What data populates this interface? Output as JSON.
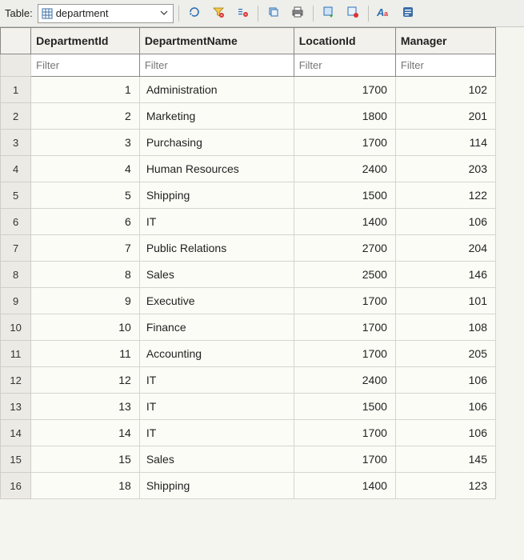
{
  "toolbar": {
    "label": "Table:",
    "table_name": "department",
    "icons": {
      "refresh": "refresh-icon",
      "filter": "filter-icon",
      "clear_filter": "clear-filter-icon",
      "copy": "copy-icon",
      "print": "print-icon",
      "export_sql": "export-sql-icon",
      "export": "export-icon",
      "format": "format-icon",
      "more": "more-icon"
    }
  },
  "grid": {
    "columns": [
      {
        "key": "DepartmentId",
        "label": "DepartmentId",
        "filter_placeholder": "Filter"
      },
      {
        "key": "DepartmentName",
        "label": "DepartmentName",
        "filter_placeholder": "Filter"
      },
      {
        "key": "LocationId",
        "label": "LocationId",
        "filter_placeholder": "Filter"
      },
      {
        "key": "Manager",
        "label": "Manager",
        "filter_placeholder": "Filter"
      }
    ],
    "rows": [
      {
        "n": "1",
        "DepartmentId": "1",
        "DepartmentName": "Administration",
        "LocationId": "1700",
        "Manager": "102"
      },
      {
        "n": "2",
        "DepartmentId": "2",
        "DepartmentName": "Marketing",
        "LocationId": "1800",
        "Manager": "201"
      },
      {
        "n": "3",
        "DepartmentId": "3",
        "DepartmentName": "Purchasing",
        "LocationId": "1700",
        "Manager": "114"
      },
      {
        "n": "4",
        "DepartmentId": "4",
        "DepartmentName": "Human Resources",
        "LocationId": "2400",
        "Manager": "203"
      },
      {
        "n": "5",
        "DepartmentId": "5",
        "DepartmentName": "Shipping",
        "LocationId": "1500",
        "Manager": "122"
      },
      {
        "n": "6",
        "DepartmentId": "6",
        "DepartmentName": "IT",
        "LocationId": "1400",
        "Manager": "106"
      },
      {
        "n": "7",
        "DepartmentId": "7",
        "DepartmentName": "Public Relations",
        "LocationId": "2700",
        "Manager": "204"
      },
      {
        "n": "8",
        "DepartmentId": "8",
        "DepartmentName": "Sales",
        "LocationId": "2500",
        "Manager": "146"
      },
      {
        "n": "9",
        "DepartmentId": "9",
        "DepartmentName": "Executive",
        "LocationId": "1700",
        "Manager": "101"
      },
      {
        "n": "10",
        "DepartmentId": "10",
        "DepartmentName": "Finance",
        "LocationId": "1700",
        "Manager": "108"
      },
      {
        "n": "11",
        "DepartmentId": "11",
        "DepartmentName": "Accounting",
        "LocationId": "1700",
        "Manager": "205"
      },
      {
        "n": "12",
        "DepartmentId": "12",
        "DepartmentName": "IT",
        "LocationId": "2400",
        "Manager": "106"
      },
      {
        "n": "13",
        "DepartmentId": "13",
        "DepartmentName": "IT",
        "LocationId": "1500",
        "Manager": "106"
      },
      {
        "n": "14",
        "DepartmentId": "14",
        "DepartmentName": "IT",
        "LocationId": "1700",
        "Manager": "106"
      },
      {
        "n": "15",
        "DepartmentId": "15",
        "DepartmentName": "Sales",
        "LocationId": "1700",
        "Manager": "145"
      },
      {
        "n": "16",
        "DepartmentId": "18",
        "DepartmentName": "Shipping",
        "LocationId": "1400",
        "Manager": "123"
      }
    ]
  }
}
